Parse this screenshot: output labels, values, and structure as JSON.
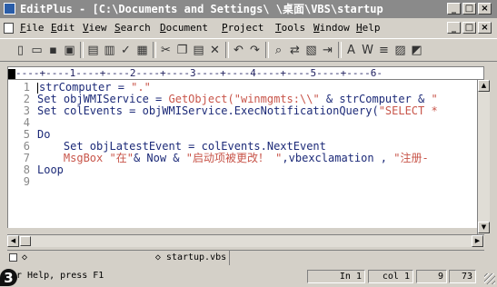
{
  "window": {
    "title": "EditPlus - [C:\\Documents and Settings\\        \\桌面\\VBS\\startup",
    "controls": [
      "_",
      "□",
      "×"
    ]
  },
  "menubar": {
    "items": [
      {
        "mnemonic": "F",
        "rest": "ile"
      },
      {
        "mnemonic": "E",
        "rest": "dit"
      },
      {
        "mnemonic": "V",
        "rest": "iew"
      },
      {
        "mnemonic": "S",
        "rest": "earch"
      },
      {
        "mnemonic": "D",
        "rest": "ocument"
      },
      {
        "mnemonic": "P",
        "rest": "roject"
      },
      {
        "mnemonic": "T",
        "rest": "ools"
      },
      {
        "mnemonic": "W",
        "rest": "indow"
      },
      {
        "mnemonic": "H",
        "rest": "elp"
      }
    ],
    "doc_controls": [
      "_",
      "□",
      "×"
    ]
  },
  "toolbar": {
    "buttons": [
      "new-icon",
      "open-icon",
      "save-icon",
      "save-all-icon",
      "print-preview-icon",
      "print-icon",
      "spellcheck-icon",
      "browser-icon",
      "cut-icon",
      "copy-icon",
      "paste-icon",
      "delete-icon",
      "undo-icon",
      "redo-icon",
      "find-icon",
      "replace-icon",
      "clipboard-icon",
      "indent-icon",
      "font-icon",
      "bold-icon",
      "word-wrap-icon",
      "hex-icon",
      "html-icon"
    ]
  },
  "ruler": {
    "text": "----+----1----+----2----+----3----+----4----+----5----+----6-"
  },
  "editor": {
    "line_numbers": [
      "1",
      "2",
      "3",
      "4",
      "5",
      "6",
      "7",
      "8",
      "9"
    ],
    "lines": [
      [
        {
          "t": "strComputer = "
        },
        {
          "t": "\".\"",
          "s": "str"
        }
      ],
      [
        {
          "t": "Set objWMIService = "
        },
        {
          "t": "GetObject(\"winmgmts:\\\\\"",
          "s": "str"
        },
        {
          "t": " & strComputer & "
        },
        {
          "t": "\"",
          "s": "str"
        }
      ],
      [
        {
          "t": "Set colEvents = objWMIService.ExecNotificationQuery("
        },
        {
          "t": "\"SELECT *",
          "s": "str"
        }
      ],
      [
        {
          "t": ""
        }
      ],
      [
        {
          "t": "Do"
        }
      ],
      [
        {
          "t": "    Set objLatestEvent = colEvents.NextEvent"
        }
      ],
      [
        {
          "t": "    MsgBox ",
          "s": "red"
        },
        {
          "t": "\"在\"",
          "s": "str"
        },
        {
          "t": "& Now & "
        },
        {
          "t": "\"启动项被更改！ \"",
          "s": "str"
        },
        {
          "t": ",vbexclamation , "
        },
        {
          "t": "\"注册-",
          "s": "str"
        }
      ],
      [
        {
          "t": "Loop"
        }
      ],
      [
        {
          "t": ""
        }
      ]
    ]
  },
  "tabs": {
    "active": "startup.vbs"
  },
  "status": {
    "help": "r Help, press F1",
    "ln": "In 1",
    "col": "col 1",
    "n1": "9",
    "n2": "73"
  },
  "badge": "3"
}
